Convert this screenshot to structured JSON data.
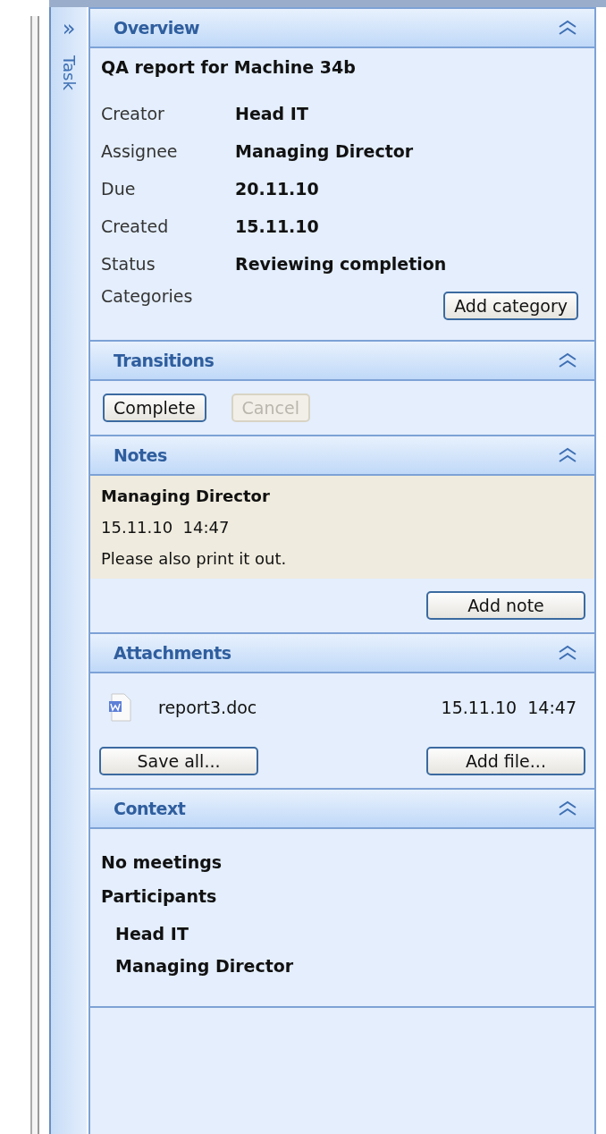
{
  "side_tab": {
    "expand_glyph": "»",
    "label": "Task"
  },
  "overview": {
    "title": "Overview",
    "subject": "QA report for Machine 34b",
    "fields": [
      {
        "label": "Creator",
        "value": "Head IT"
      },
      {
        "label": "Assignee",
        "value": "Managing Director"
      },
      {
        "label": "Due",
        "value": "20.11.10"
      },
      {
        "label": "Created",
        "value": "15.11.10"
      },
      {
        "label": "Status",
        "value": "Reviewing completion"
      }
    ],
    "categories_label": "Categories",
    "button": "Add category"
  },
  "transitions": {
    "title": "Transitions",
    "buttons": [
      {
        "label": "Complete",
        "disabled": false
      },
      {
        "label": "Cancel",
        "disabled": true
      }
    ]
  },
  "notes": {
    "title": "Notes",
    "items": [
      {
        "author": "Managing Director",
        "time": "15.11.10  14:47",
        "text": "Please also print it out."
      }
    ],
    "button": "Add note"
  },
  "attachments": {
    "title": "Attachments",
    "files": [
      {
        "name": "report3.doc",
        "time": "15.11.10  14:47"
      }
    ],
    "buttons": [
      "Save all...",
      "Add file..."
    ]
  },
  "context": {
    "title": "Context",
    "meetings": "No meetings",
    "participants_label": "Participants",
    "participants": [
      "Head IT",
      "Managing Director"
    ]
  }
}
